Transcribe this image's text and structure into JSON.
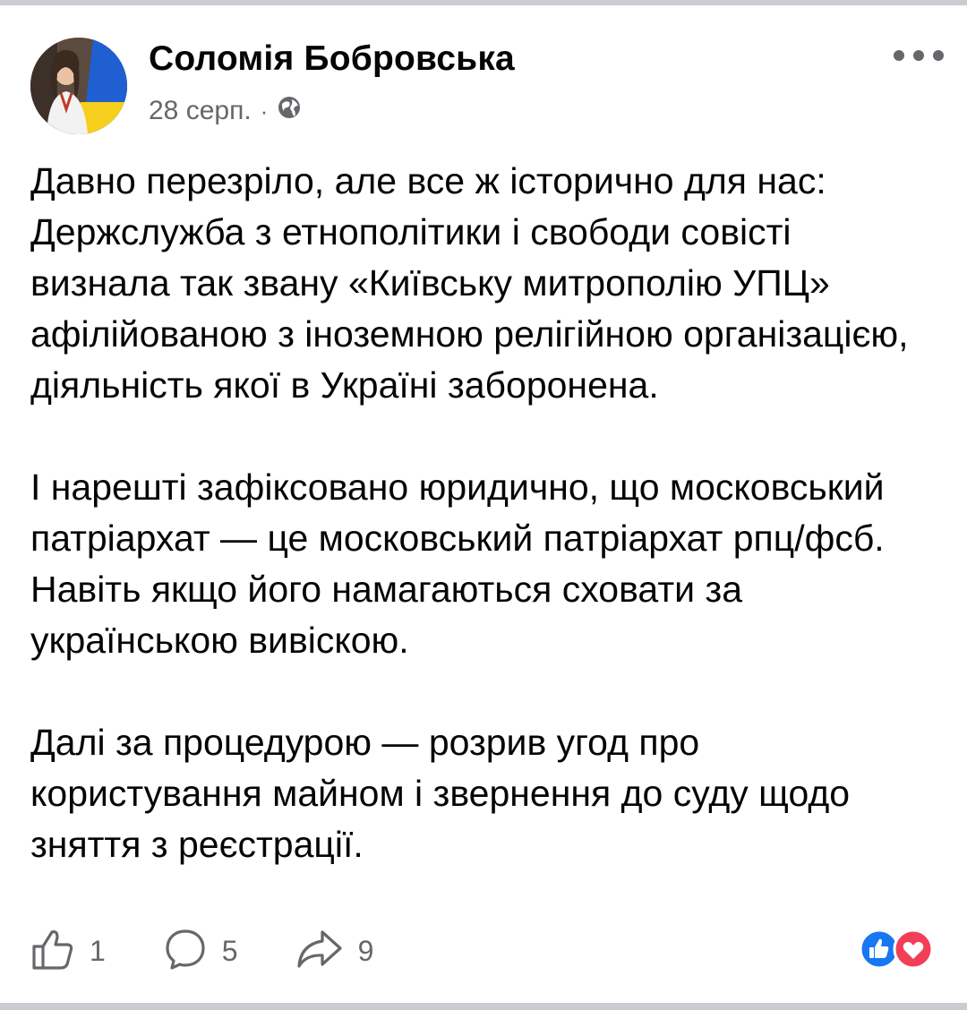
{
  "post": {
    "author": "Соломія Бобровська",
    "timestamp": "28 серп.",
    "separator": "·",
    "audience_icon": "globe-icon",
    "paragraphs": [
      "Давно перезріло, але все ж історично для нас: Держслужба з етнополітики і свободи совісті визнала так звану «Київську митрополію УПЦ» афілійованою з іноземною релігійною організацією, діяльність якої в Україні заборонена.",
      "І нарешті зафіксовано юридично, що московський патріархат — це московський патріархат рпц/фсб. Навіть якщо його намагаються сховати за українською вивіскою.",
      "Далі за процедурою — розрив угод про користування майном і звернення до суду щодо зняття з реєстрації."
    ]
  },
  "actions": {
    "like_count": "1",
    "comment_count": "5",
    "share_count": "9"
  },
  "colors": {
    "text": "#050505",
    "secondary": "#65676b",
    "like_blue": "#1877f2",
    "love_red": "#f33e58",
    "divider": "#c9ccd1"
  }
}
